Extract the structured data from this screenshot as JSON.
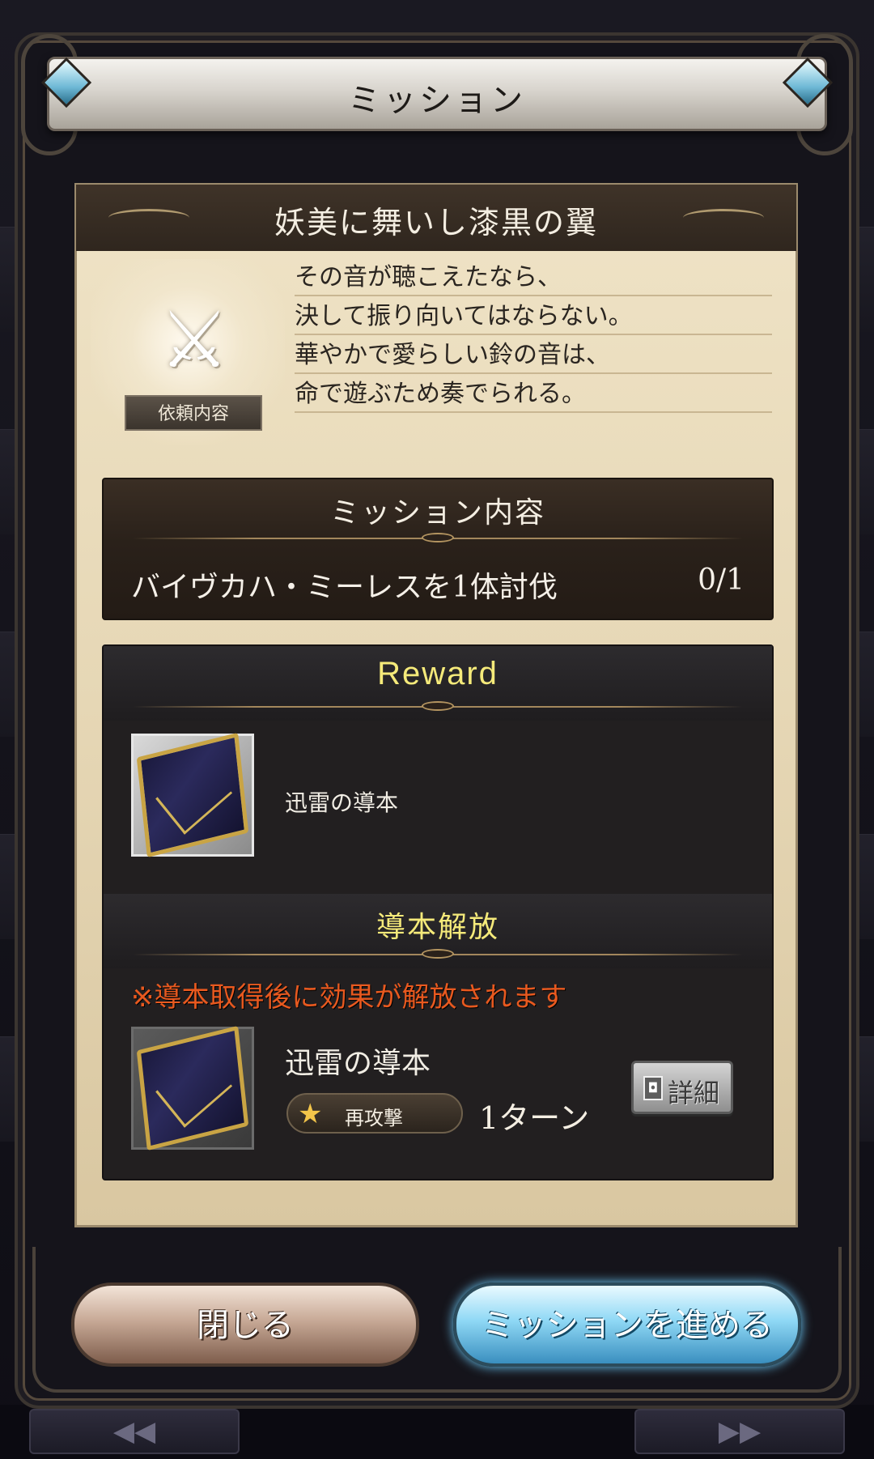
{
  "modal": {
    "title": "ミッション"
  },
  "quest": {
    "name": "妖美に舞いし漆黒の翼",
    "request_label": "依頼内容",
    "flavor_lines": [
      "その音が聴こえたなら、",
      "決して振り向いてはならない。",
      "華やかで愛らしい鈴の音は、",
      "命で遊ぶため奏でられる。"
    ]
  },
  "mission": {
    "section_title": "ミッション内容",
    "objective": "バイヴカハ・ミーレスを1体討伐",
    "progress": "0/1"
  },
  "reward": {
    "section_title": "Reward",
    "item_name": "迅雷の導本"
  },
  "unlock": {
    "section_title": "導本解放",
    "notice": "※導本取得後に効果が解放されます",
    "item_name": "迅雷の導本",
    "skill_label": "再攻撃",
    "duration": "1ターン",
    "detail_button": "詳細"
  },
  "buttons": {
    "close": "閉じる",
    "proceed": "ミッションを進める"
  },
  "colors": {
    "reward_title": "#f5ea7a",
    "unlock_title": "#f5ea7a",
    "notice": "#e8591f",
    "parchment": "#e6d7b5"
  }
}
